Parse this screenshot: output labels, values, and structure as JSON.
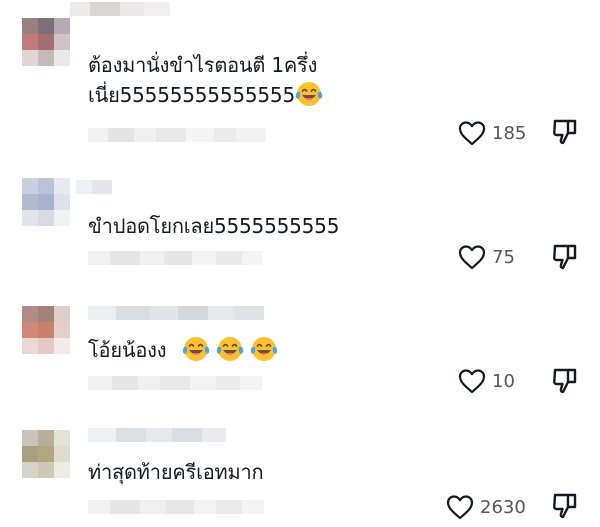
{
  "comments": [
    {
      "text": "ต้องมานั่งขำไรตอนตี 1ครึ่ง",
      "text2": "เนี่ย55555555555555",
      "likes": "185",
      "emoji_count": 1,
      "avatar_colors": [
        "#9a7f7d",
        "#7c6e7a",
        "#b8aab4",
        "#c27b7d",
        "#a56e72",
        "#cfc3c6",
        "#e0d6d7",
        "#c7b8ba",
        "#ece7e8"
      ]
    },
    {
      "text": "ขำปอดโยกเลย5555555555",
      "likes": "75",
      "emoji_count": 0,
      "avatar_colors": [
        "#c8d0e0",
        "#b9c2d9",
        "#e6e9f1",
        "#b2b9cf",
        "#a9b2cb",
        "#dee1ea",
        "#e2e4ec",
        "#d7dbe6",
        "#f1f2f6"
      ]
    },
    {
      "text": "โอ้ยน้องง",
      "likes": "10",
      "emoji_count": 3,
      "avatar_colors": [
        "#b38c88",
        "#a38379",
        "#ddd0cc",
        "#d48777",
        "#c8816e",
        "#e6cfc8",
        "#ead8d4",
        "#e3c9c1",
        "#f3ebe9"
      ]
    },
    {
      "text": "ท่าสุดท้ายครีเอทมาก",
      "likes": "2630",
      "emoji_count": 0,
      "avatar_colors": [
        "#c9c4b7",
        "#b7ae98",
        "#e4e1d9",
        "#a99f84",
        "#b4a67f",
        "#dedbd1",
        "#d8d3c6",
        "#cfc8b6",
        "#ecebe6"
      ]
    }
  ],
  "icons": {
    "like": "heart-outline-icon",
    "dislike": "thumbs-down-outline-icon",
    "emoji": "face-with-tears-of-joy-icon"
  },
  "colors": {
    "text": "#161823",
    "count": "#555555",
    "icon": "#161823",
    "emoji_face": "#fbc02d",
    "emoji_tears": "#4fa3e0"
  }
}
